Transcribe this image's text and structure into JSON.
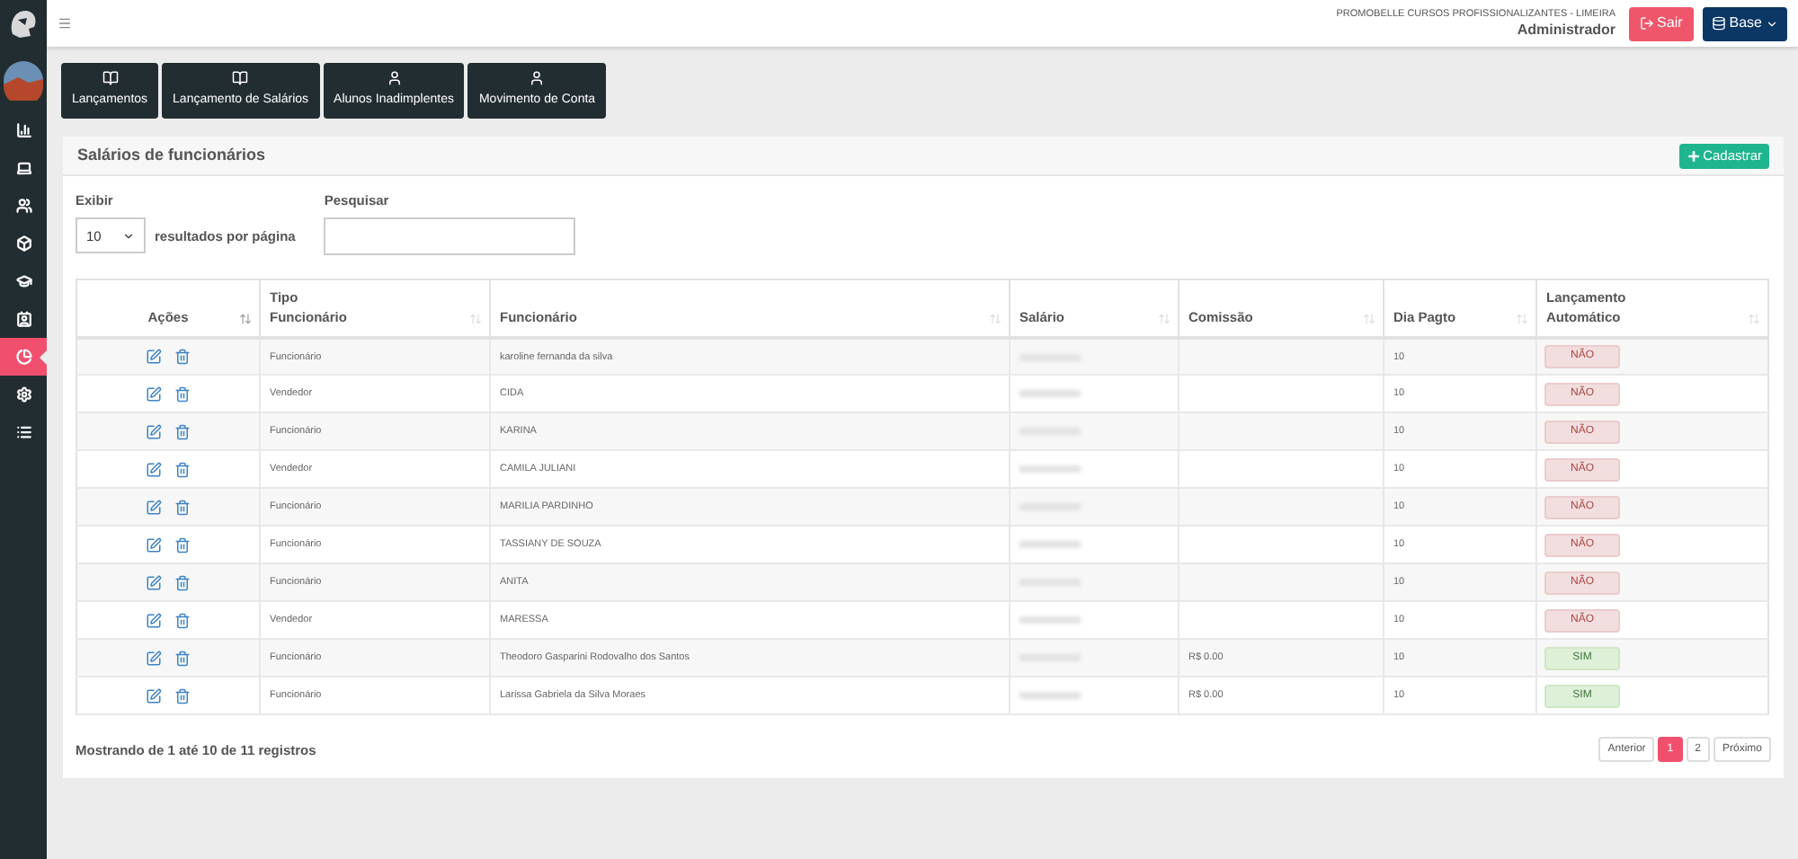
{
  "sidebar": {
    "items": [
      {
        "kind": "chart",
        "selected": false
      },
      {
        "kind": "laptop",
        "selected": false
      },
      {
        "kind": "users",
        "selected": false
      },
      {
        "kind": "cube",
        "selected": false
      },
      {
        "kind": "cap",
        "selected": false
      },
      {
        "kind": "contact",
        "selected": false
      },
      {
        "kind": "pie",
        "selected": true
      },
      {
        "kind": "gear",
        "selected": false
      },
      {
        "kind": "list",
        "selected": false
      }
    ]
  },
  "topbar": {
    "company": "PROMOBELLE CURSOS PROFISSIONALIZANTES - LIMEIRA",
    "user": "Administrador",
    "logout": "Sair",
    "base": "Base"
  },
  "shortcuts": [
    {
      "label": "Lançamentos",
      "kind": "book"
    },
    {
      "label": "Lançamento de Salários",
      "kind": "book"
    },
    {
      "label": "Alunos Inadimplentes",
      "kind": "user"
    },
    {
      "label": "Movimento de Conta",
      "kind": "user"
    }
  ],
  "panel": {
    "title": "Salários de funcionários",
    "add": "Cadastrar",
    "length_label": "Exibir",
    "length_value": "10",
    "length_suffix": "resultados por página",
    "search_label": "Pesquisar",
    "columns": [
      "Ações",
      "Tipo Funcionário",
      "Funcionário",
      "Salário",
      "Comissão",
      "Dia Pagto",
      "Lançamento Automático"
    ],
    "rows": [
      {
        "type": "Funcionário",
        "name": "karoline fernanda da silva",
        "commission": "",
        "day": "10",
        "auto": {
          "label": "NÃO",
          "on": false
        }
      },
      {
        "type": "Vendedor",
        "name": "CIDA",
        "commission": "",
        "day": "10",
        "auto": {
          "label": "NÃO",
          "on": false
        }
      },
      {
        "type": "Funcionário",
        "name": "KARINA",
        "commission": "",
        "day": "10",
        "auto": {
          "label": "NÃO",
          "on": false
        }
      },
      {
        "type": "Vendedor",
        "name": "CAMILA JULIANI",
        "commission": "",
        "day": "10",
        "auto": {
          "label": "NÃO",
          "on": false
        }
      },
      {
        "type": "Funcionário",
        "name": "MARILIA PARDINHO",
        "commission": "",
        "day": "10",
        "auto": {
          "label": "NÃO",
          "on": false
        }
      },
      {
        "type": "Funcionário",
        "name": "TASSIANY DE SOUZA",
        "commission": "",
        "day": "10",
        "auto": {
          "label": "NÃO",
          "on": false
        }
      },
      {
        "type": "Funcionário",
        "name": "ANITA",
        "commission": "",
        "day": "10",
        "auto": {
          "label": "NÃO",
          "on": false
        }
      },
      {
        "type": "Vendedor",
        "name": "MARESSA",
        "commission": "",
        "day": "10",
        "auto": {
          "label": "NÃO",
          "on": false
        }
      },
      {
        "type": "Funcionário",
        "name": "Theodoro Gasparini Rodovalho dos Santos",
        "commission": "R$ 0.00",
        "day": "10",
        "auto": {
          "label": "SIM",
          "on": true
        }
      },
      {
        "type": "Funcionário",
        "name": "Larissa Gabriela da Silva Moraes",
        "commission": "R$ 0.00",
        "day": "10",
        "auto": {
          "label": "SIM",
          "on": true
        }
      }
    ],
    "info": "Mostrando de 1 até 10 de 11 registros",
    "pagination": [
      {
        "label": "Anterior",
        "selected": false
      },
      {
        "label": "1",
        "selected": true
      },
      {
        "label": "2",
        "selected": false
      },
      {
        "label": "Próximo",
        "selected": false
      }
    ]
  }
}
